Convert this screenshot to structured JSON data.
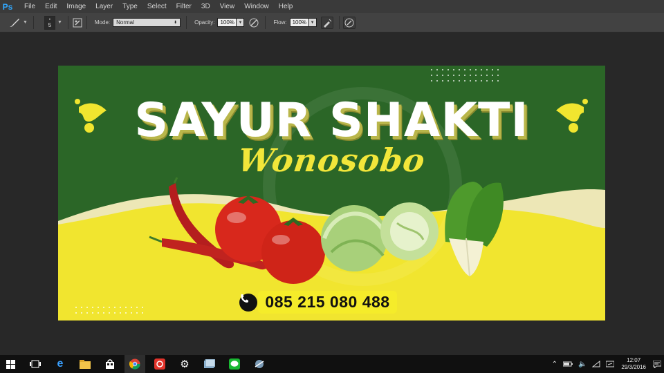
{
  "app": {
    "logo": "Ps",
    "menu": [
      "File",
      "Edit",
      "Image",
      "Layer",
      "Type",
      "Select",
      "Filter",
      "3D",
      "View",
      "Window",
      "Help"
    ]
  },
  "options": {
    "brush_size": "5",
    "mode_label": "Mode:",
    "mode_value": "Normal",
    "opacity_label": "Opacity:",
    "opacity_value": "100%",
    "flow_label": "Flow:",
    "flow_value": "100%"
  },
  "design": {
    "title": "SAYUR SHAKTI",
    "subtitle": "Wonosobo",
    "phone": "085 215 080 488",
    "colors": {
      "green": "#2b6627",
      "yellow": "#f2e63a",
      "cream": "#f1ecc0",
      "white": "#ffffff"
    }
  },
  "taskbar": {
    "icons": [
      "start-icon",
      "task-view-icon",
      "edge-icon",
      "file-explorer-icon",
      "store-icon",
      "chrome-icon",
      "app-icon",
      "settings-icon",
      "photos-icon",
      "line-icon",
      "media-icon"
    ],
    "time": "12:07",
    "date": "29/3/2016"
  }
}
